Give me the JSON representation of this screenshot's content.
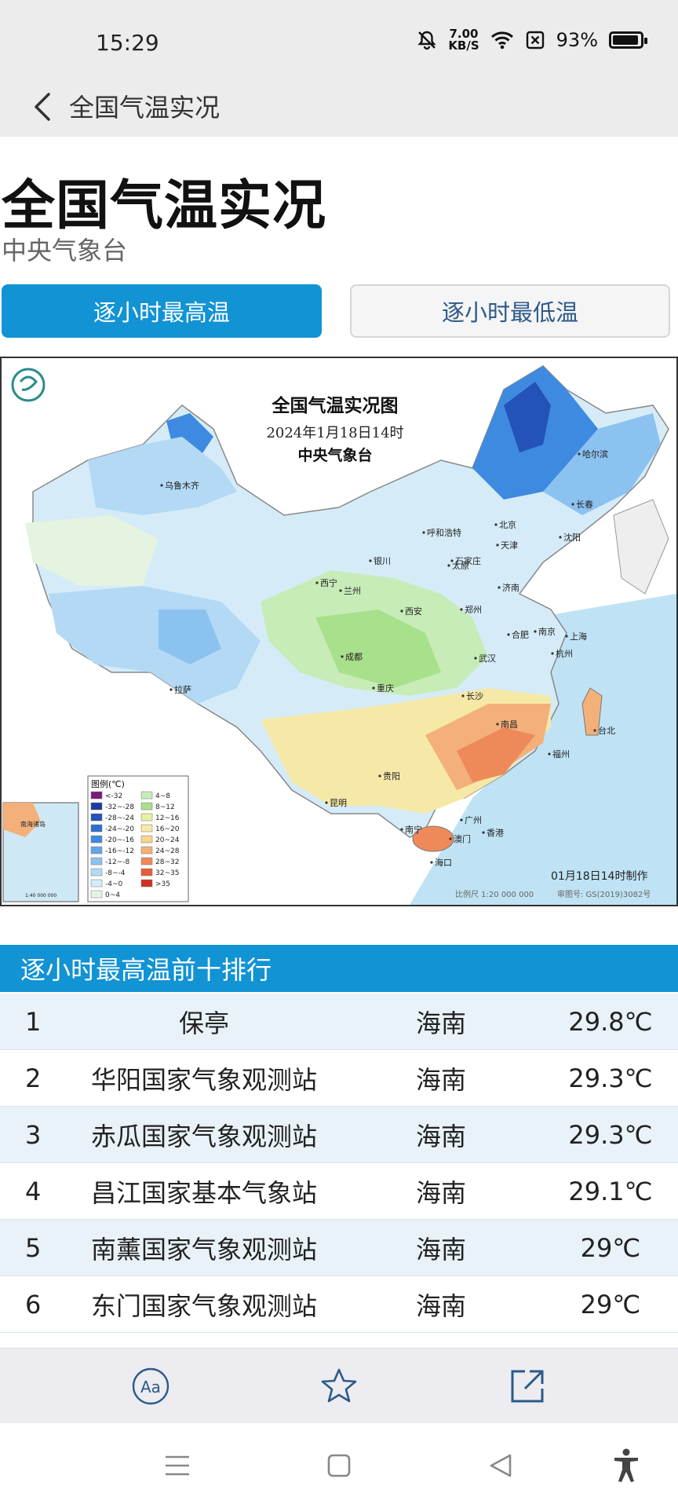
{
  "status": {
    "time": "15:29",
    "net_speed_top": "7.00",
    "net_speed_bottom": "KB/S",
    "battery": "93%",
    "battery_level": 0.93
  },
  "app_bar": {
    "title": "全国气温实况"
  },
  "page": {
    "title": "全国气温实况",
    "subtitle": "中央气象台"
  },
  "tabs": [
    {
      "label": "逐小时最高温",
      "active": true
    },
    {
      "label": "逐小时最低温",
      "active": false
    }
  ],
  "map": {
    "title": "全国气温实况图",
    "date": "2024年1月18日14时",
    "agency": "中央气象台",
    "legend_title": "图例(℃)",
    "legend": [
      {
        "label": "<-32",
        "color": "#7a1a7a"
      },
      {
        "label": "-32~-28",
        "color": "#1f3b9c"
      },
      {
        "label": "-28~-24",
        "color": "#2452b8"
      },
      {
        "label": "-24~-20",
        "color": "#2d6fd0"
      },
      {
        "label": "-20~-16",
        "color": "#3d8ae0"
      },
      {
        "label": "-16~-12",
        "color": "#62a6ea"
      },
      {
        "label": "-12~-8",
        "color": "#8cc2f0"
      },
      {
        "label": "-8~-4",
        "color": "#b3d9f5"
      },
      {
        "label": "-4~0",
        "color": "#d5ecf8"
      },
      {
        "label": "0~4",
        "color": "#e4f4e0"
      },
      {
        "label": "4~8",
        "color": "#c8ecb8"
      },
      {
        "label": "8~12",
        "color": "#a8e08c"
      },
      {
        "label": "12~16",
        "color": "#e6f0a0"
      },
      {
        "label": "16~20",
        "color": "#f6e8a6"
      },
      {
        "label": "20~24",
        "color": "#f8d490"
      },
      {
        "label": "24~28",
        "color": "#f4b07a"
      },
      {
        "label": "28~32",
        "color": "#ee8a5a"
      },
      {
        "label": "32~35",
        "color": "#e65c36"
      },
      {
        "label": ">35",
        "color": "#d03020"
      }
    ],
    "cities": [
      "乌鲁木齐",
      "哈尔滨",
      "长春",
      "沈阳",
      "北京",
      "天津",
      "呼和浩特",
      "石家庄",
      "太原",
      "银川",
      "济南",
      "西宁",
      "兰州",
      "郑州",
      "西安",
      "南京",
      "合肥",
      "上海",
      "杭州",
      "武汉",
      "成都",
      "重庆",
      "拉萨",
      "长沙",
      "南昌",
      "福州",
      "台北",
      "贵阳",
      "昆明",
      "南宁",
      "广州",
      "澳门",
      "香港",
      "海口"
    ],
    "footer_made": "01月18日14时制作",
    "footer_scale": "比例尺 1:20 000 000",
    "footer_map_no": "审图号: GS(2019)3082号",
    "inset_label_1": "南海诸岛",
    "inset_label_2": "1:40 000 000"
  },
  "ranking": {
    "header": "逐小时最高温前十排行",
    "rows": [
      {
        "rank": "1",
        "name": "保亭",
        "province": "海南",
        "temp": "29.8℃"
      },
      {
        "rank": "2",
        "name": "华阳国家气象观测站",
        "province": "海南",
        "temp": "29.3℃"
      },
      {
        "rank": "3",
        "name": "赤瓜国家气象观测站",
        "province": "海南",
        "temp": "29.3℃"
      },
      {
        "rank": "4",
        "name": "昌江国家基本气象站",
        "province": "海南",
        "temp": "29.1℃"
      },
      {
        "rank": "5",
        "name": "南薰国家气象观测站",
        "province": "海南",
        "temp": "29℃"
      },
      {
        "rank": "6",
        "name": "东门国家气象观测站",
        "province": "海南",
        "temp": "29℃"
      }
    ]
  },
  "colors": {
    "accent": "#1193d4",
    "row_odd": "#e8f2f8",
    "row_even": "#ffffff",
    "row_stripe": "#d9eaf4"
  }
}
